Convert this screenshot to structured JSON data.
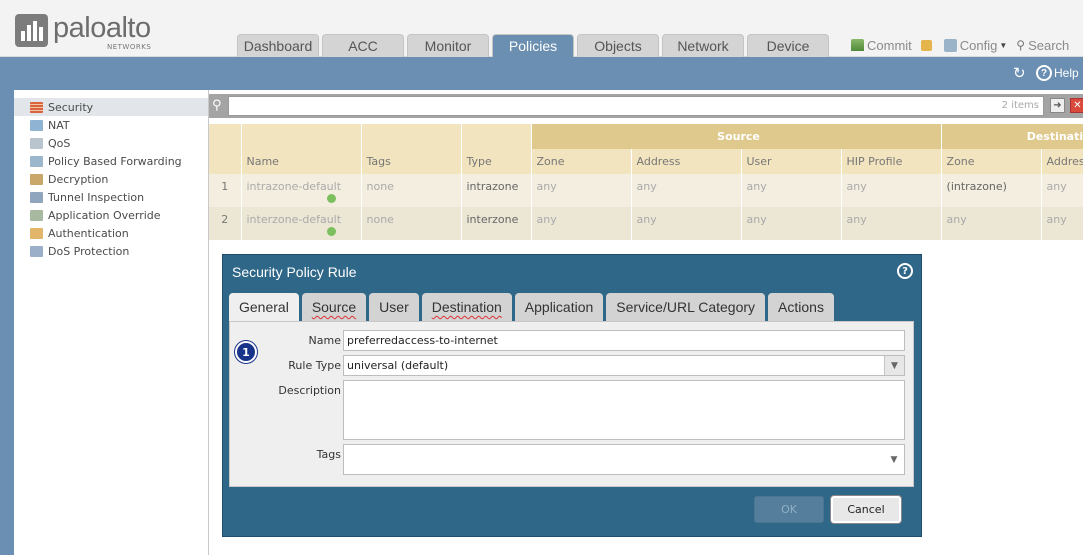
{
  "brand": {
    "name": "paloalto",
    "sub": "NETWORKS"
  },
  "tabs": [
    "Dashboard",
    "ACC",
    "Monitor",
    "Policies",
    "Objects",
    "Network",
    "Device"
  ],
  "active_tab": "Policies",
  "toplinks": {
    "commit": "Commit",
    "config": "Config",
    "search": "Search"
  },
  "bluebar": {
    "help": "Help"
  },
  "sidebar": {
    "items": [
      {
        "label": "Security",
        "icon": "firewall-icon",
        "active": true
      },
      {
        "label": "NAT",
        "icon": "nat-icon"
      },
      {
        "label": "QoS",
        "icon": "qos-icon"
      },
      {
        "label": "Policy Based Forwarding",
        "icon": "pbf-icon"
      },
      {
        "label": "Decryption",
        "icon": "decryption-icon"
      },
      {
        "label": "Tunnel Inspection",
        "icon": "tunnel-icon"
      },
      {
        "label": "Application Override",
        "icon": "app-override-icon"
      },
      {
        "label": "Authentication",
        "icon": "authentication-icon"
      },
      {
        "label": "DoS Protection",
        "icon": "dos-protection-icon"
      }
    ]
  },
  "filter": {
    "count": "2 items"
  },
  "table": {
    "groups": {
      "source": "Source",
      "destination": "Destination"
    },
    "columns": [
      "Name",
      "Tags",
      "Type",
      "Zone",
      "Address",
      "User",
      "HIP Profile",
      "Zone",
      "Address"
    ],
    "rows": [
      {
        "num": "1",
        "name": "intrazone-default",
        "tags": "none",
        "type": "intrazone",
        "src_zone": "any",
        "src_address": "any",
        "src_user": "any",
        "hip": "any",
        "dst_zone": "(intrazone)",
        "dst_address": "any"
      },
      {
        "num": "2",
        "name": "interzone-default",
        "tags": "none",
        "type": "interzone",
        "src_zone": "any",
        "src_address": "any",
        "src_user": "any",
        "hip": "any",
        "dst_zone": "any",
        "dst_address": "any"
      }
    ]
  },
  "dialog": {
    "title": "Security Policy Rule",
    "tabs": [
      "General",
      "Source",
      "User",
      "Destination",
      "Application",
      "Service/URL Category",
      "Actions"
    ],
    "active_tab": "General",
    "step_badge": "1",
    "fields": {
      "name_label": "Name",
      "name_value": "preferredaccess-to-internet",
      "rule_type_label": "Rule Type",
      "rule_type_value": "universal (default)",
      "description_label": "Description",
      "description_value": "",
      "tags_label": "Tags",
      "tags_value": ""
    },
    "ok": "OK",
    "cancel": "Cancel"
  },
  "colors": {
    "header_blue": "#6a8fb2",
    "dialog_blue": "#2f6788",
    "table_header": "#f2e4bf",
    "group_header": "#dfc98d"
  }
}
